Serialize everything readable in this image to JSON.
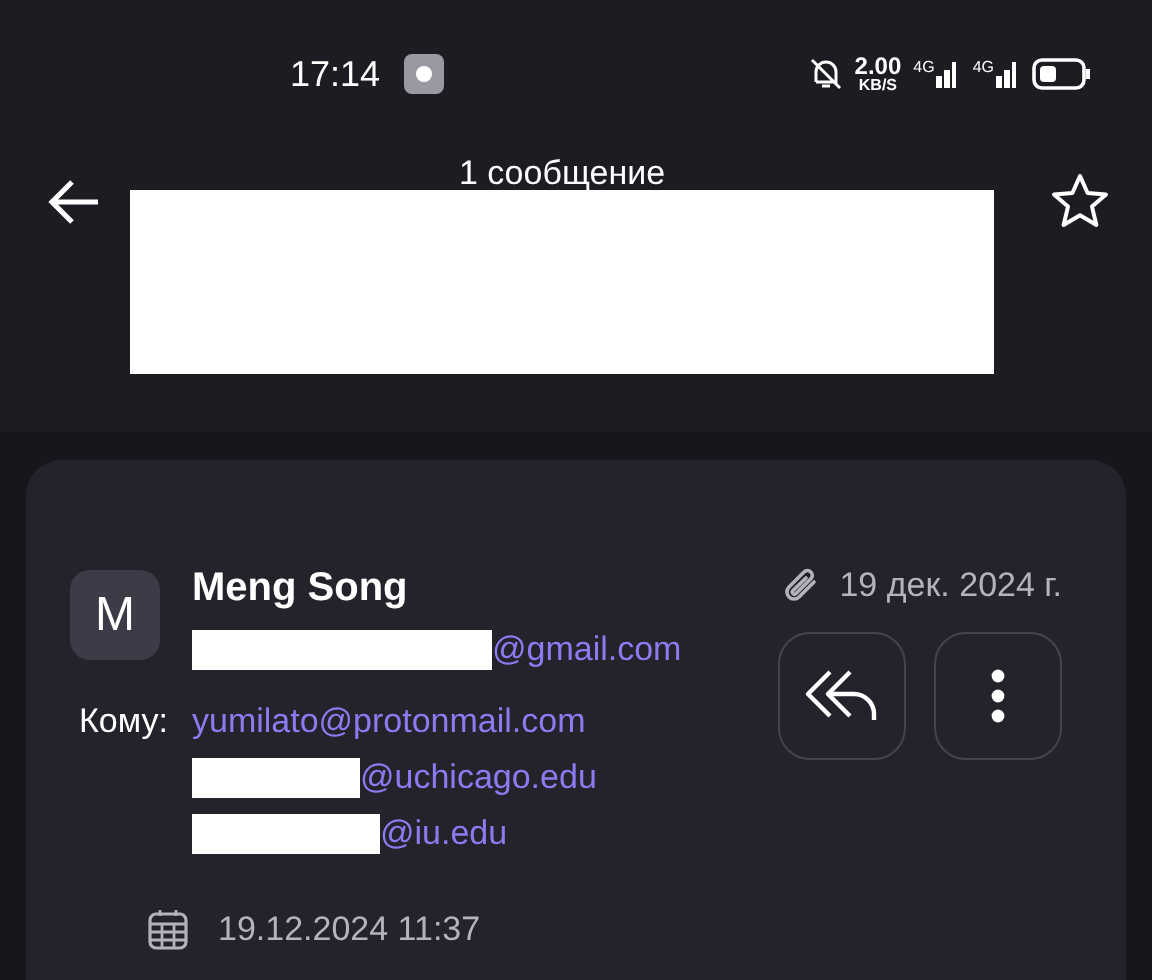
{
  "status_bar": {
    "time": "17:14",
    "speed_value": "2.00",
    "speed_unit": "KB/S",
    "networks": [
      "4G",
      "4G"
    ]
  },
  "header": {
    "title": "1 сообщение",
    "starred": false
  },
  "message": {
    "avatar_letter": "M",
    "sender_name": "Meng Song",
    "sender_email": "@gmail.com",
    "date": "19 дек. 2024 г.",
    "has_attachment": true,
    "to_label": "Кому:",
    "recipients": [
      {
        "address": "yumilato@protonmail.com",
        "redacted": false
      },
      {
        "address": "@uchicago.edu",
        "redacted": true
      },
      {
        "address": "@iu.edu",
        "redacted": true
      }
    ],
    "datetime": "19.12.2024 11:37"
  }
}
